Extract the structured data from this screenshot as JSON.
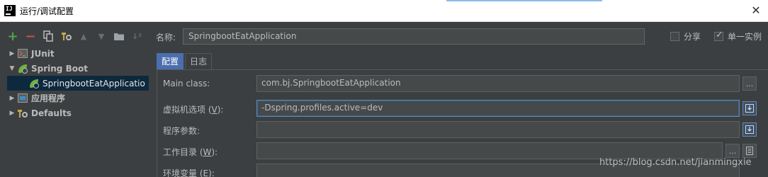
{
  "window": {
    "app_icon_text": "IJ",
    "title": "运行/调试配置",
    "close_glyph": "✕"
  },
  "toolbar": {
    "add": "+",
    "remove": "−",
    "copy": "⎘",
    "settings": "⚒",
    "up": "▲",
    "down": "▼",
    "folder": "▬",
    "sort": "↓²"
  },
  "tree": {
    "items": [
      {
        "label": "JUnit",
        "expanded": false,
        "icon": "junit-icon"
      },
      {
        "label": "Spring Boot",
        "expanded": true,
        "icon": "spring-boot-icon"
      },
      {
        "label": "SpringbootEatApplicatio",
        "selected": true,
        "icon": "spring-boot-icon"
      },
      {
        "label": "应用程序",
        "expanded": false,
        "icon": "application-icon"
      },
      {
        "label": "Defaults",
        "expanded": false,
        "icon": "wrench-icon"
      }
    ]
  },
  "name": {
    "label": "名称:",
    "value": "SpringbootEatApplication"
  },
  "options": {
    "share_label": "分享",
    "share_checked": false,
    "single_instance_label": "单一实例",
    "single_instance_checked": true
  },
  "tabs": [
    {
      "label": "配置",
      "active": true
    },
    {
      "label": "日志",
      "active": false
    }
  ],
  "form": {
    "main_class_label": "Main class:",
    "main_class_value": "com.bj.SpringbootEatApplication",
    "vm_options_label": "虚拟机选项 (",
    "vm_options_mnemonic": "V",
    "vm_options_suffix": "):",
    "vm_options_value": "-Dspring.profiles.active=dev",
    "program_args_label": "程序参数:",
    "program_args_value": "",
    "working_dir_label": "工作目录 (",
    "working_dir_mnemonic": "W",
    "working_dir_suffix": "):",
    "working_dir_value": "",
    "env_vars_label": "环境变量 (",
    "env_vars_mnemonic": "E",
    "env_vars_suffix": "):",
    "ellipsis": "..."
  },
  "watermark": "https://blog.csdn.net/jianmingxie",
  "colors": {
    "background": "#3c3f41",
    "selection": "#0d293e",
    "active_tab": "#4b6eaf",
    "add_green": "#4fa54a",
    "remove_red": "#c7504a",
    "spring_green": "#6db33f"
  }
}
